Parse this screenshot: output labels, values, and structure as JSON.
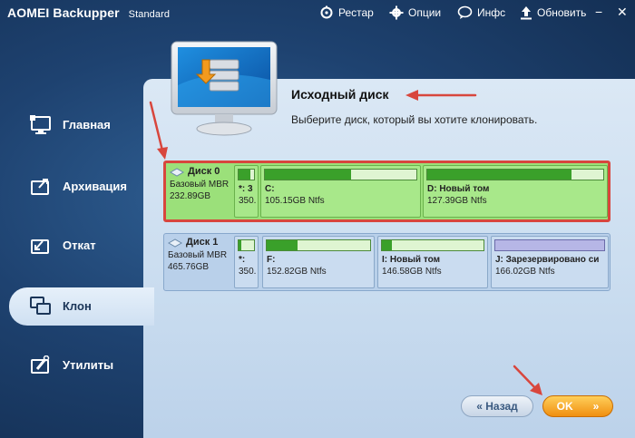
{
  "titlebar": {
    "app_name": "AOMEI Backupper",
    "edition": "Standard",
    "buttons": [
      {
        "label": "Рестар",
        "icon": "restart-icon"
      },
      {
        "label": "Опции",
        "icon": "gear-icon"
      },
      {
        "label": "Инфс",
        "icon": "chat-icon"
      },
      {
        "label": "Обновить",
        "icon": "update-icon"
      }
    ],
    "minimize": "−",
    "close": "✕"
  },
  "sidebar": {
    "items": [
      {
        "label": "Главная",
        "icon": "home-monitor-icon",
        "active": false
      },
      {
        "label": "Архивация",
        "icon": "backup-icon",
        "active": false
      },
      {
        "label": "Откат",
        "icon": "restore-icon",
        "active": false
      },
      {
        "label": "Клон",
        "icon": "clone-icon",
        "active": true
      },
      {
        "label": "Утилиты",
        "icon": "tools-icon",
        "active": false
      }
    ]
  },
  "main": {
    "heading": "Исходный диск",
    "subheading": "Выберите диск, который вы хотите клонировать."
  },
  "disks": [
    {
      "name": "Диск 0",
      "type": "Базовый MBR",
      "size": "232.89GB",
      "selected": true,
      "partitions": [
        {
          "name": "*: 3",
          "size": "350.",
          "used_fraction": 0.75
        },
        {
          "name": "C:",
          "size": "105.15GB Ntfs",
          "used_fraction": 0.57
        },
        {
          "name": "D: Новый том",
          "size": "127.39GB Ntfs",
          "used_fraction": 0.82
        }
      ]
    },
    {
      "name": "Диск 1",
      "type": "Базовый MBR",
      "size": "465.76GB",
      "selected": false,
      "partitions": [
        {
          "name": "*:",
          "size": "350.",
          "used_fraction": 0.2
        },
        {
          "name": "F:",
          "size": "152.82GB Ntfs",
          "used_fraction": 0.3
        },
        {
          "name": "I: Новый том",
          "size": "146.58GB Ntfs",
          "used_fraction": 0.1
        },
        {
          "name": "J: Зарезервировано си",
          "size": "166.02GB Ntfs",
          "used_fraction": 0.0
        }
      ]
    }
  ],
  "buttons": {
    "back": "« Назад",
    "ok": "OK"
  },
  "colors": {
    "accent_orange": "#f08f10",
    "selection_green": "#9be07a",
    "annotation_red": "#d8463d"
  }
}
